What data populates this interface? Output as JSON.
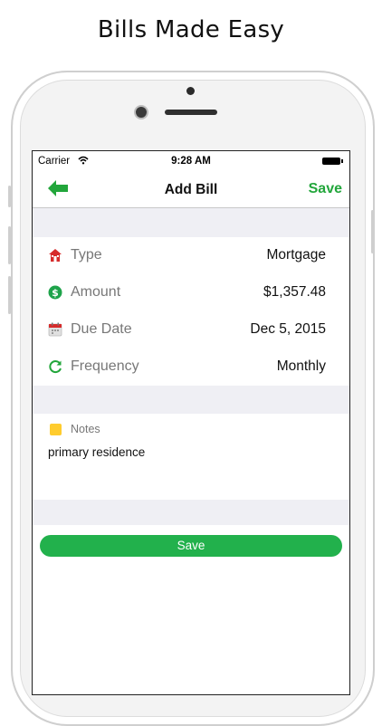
{
  "marketing": {
    "title": "Bills Made Easy"
  },
  "status_bar": {
    "carrier": "Carrier",
    "time": "9:28 AM"
  },
  "nav": {
    "title": "Add Bill",
    "save_label": "Save",
    "accent_color": "#22a63b"
  },
  "fields": [
    {
      "icon": "house-icon",
      "label": "Type",
      "value": "Mortgage"
    },
    {
      "icon": "dollar-icon",
      "label": "Amount",
      "value": "$1,357.48"
    },
    {
      "icon": "calendar-icon",
      "label": "Due Date",
      "value": "Dec 5, 2015"
    },
    {
      "icon": "repeat-icon",
      "label": "Frequency",
      "value": "Monthly"
    }
  ],
  "notes": {
    "label": "Notes",
    "text": "primary residence"
  },
  "save_button": {
    "label": "Save",
    "color": "#22b14c"
  }
}
